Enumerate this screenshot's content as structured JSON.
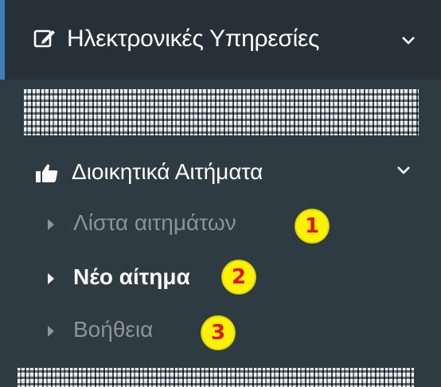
{
  "colors": {
    "sidebar_bg": "#2f3b43",
    "header_bg": "#253038",
    "accent_border": "#3f7fb5",
    "active_text": "#ffffff",
    "muted_text": "#8a949a",
    "badge_fill": "#fff200",
    "badge_text": "#e0121a"
  },
  "header": {
    "icon": "edit-icon",
    "title": "Ηλεκτρονικές Υπηρεσίες",
    "toggle_icon": "chevron-down-icon"
  },
  "group": {
    "icon": "thumbs-up-icon",
    "title": "Διοικητικά Αιτήματα",
    "toggle_icon": "chevron-down-icon",
    "items": [
      {
        "label": "Λίστα αιτημάτων",
        "active": false,
        "icon": "caret-right-icon"
      },
      {
        "label": "Νέο αίτημα",
        "active": true,
        "icon": "caret-right-icon"
      },
      {
        "label": "Βοήθεια",
        "active": false,
        "icon": "caret-right-icon"
      }
    ]
  },
  "annotations": {
    "badges": [
      "1",
      "2",
      "3"
    ]
  }
}
